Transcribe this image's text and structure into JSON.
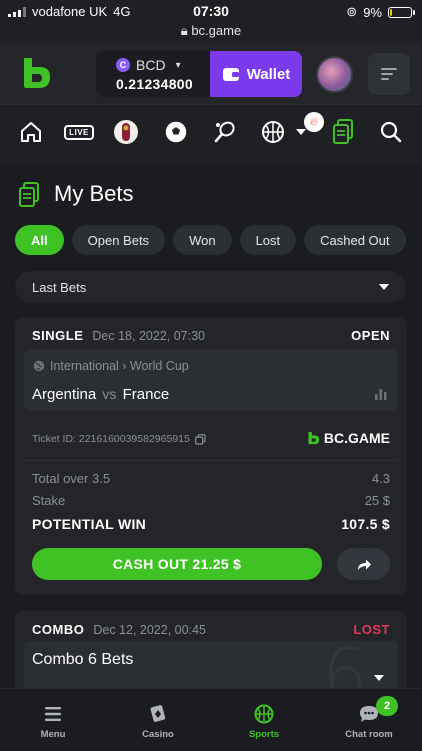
{
  "status_bar": {
    "carrier": "vodafone UK",
    "network": "4G",
    "time": "07:30",
    "url": "bc.game",
    "battery": "9%",
    "battery_level": 0.09
  },
  "header": {
    "currency": "BCD",
    "balance": "0.21234800",
    "wallet_label": "Wallet"
  },
  "sport_nav": {
    "icons": [
      "home-icon",
      "live-icon",
      "world-cup-icon",
      "soccer-icon",
      "tennis-icon",
      "basketball-icon",
      "more-dropdown-icon",
      "hot-icon",
      "my-bets-icon",
      "search-icon"
    ],
    "live_label": "LIVE"
  },
  "page": {
    "title": "My Bets"
  },
  "filters": [
    "All",
    "Open Bets",
    "Won",
    "Lost",
    "Cashed Out"
  ],
  "active_filter": "All",
  "period_select": {
    "value": "Last Bets"
  },
  "bets": [
    {
      "type": "SINGLE",
      "date": "Dec 18, 2022, 07:30",
      "status": "OPEN",
      "status_color": "#ffffff",
      "league": "International › World Cup",
      "home": "Argentina",
      "vs": "vs",
      "away": "France",
      "ticket": "Ticket ID: 2216160039582965915",
      "brand": "BC.GAME",
      "selection_label": "Total over 3.5",
      "selection_odds": "4.3",
      "stake_label": "Stake",
      "stake_value": "25 $",
      "win_label": "POTENTIAL WIN",
      "win_value": "107.5 $",
      "cashout_label": "CASH OUT 21.25 $"
    },
    {
      "type": "COMBO",
      "date": "Dec 12, 2022, 00:45",
      "status": "LOST",
      "status_color": "#e0395c",
      "title": "Combo 6 Bets",
      "big_number": "6"
    }
  ],
  "bottom_nav": [
    {
      "label": "Menu",
      "icon": "menu-icon"
    },
    {
      "label": "Casino",
      "icon": "casino-icon"
    },
    {
      "label": "Sports",
      "icon": "sports-icon",
      "active": true
    },
    {
      "label": "Chat room",
      "icon": "chat-icon",
      "badge": "2"
    }
  ],
  "colors": {
    "accent": "#3ec224",
    "wallet": "#7c3aed",
    "lost": "#e0395c"
  }
}
